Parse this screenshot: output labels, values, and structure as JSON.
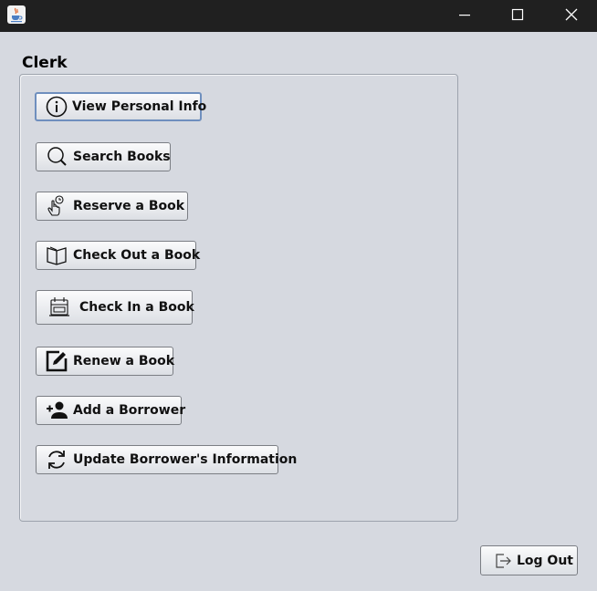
{
  "window": {
    "app_icon": "java-coffee-cup-icon",
    "controls": [
      "minimize-icon",
      "maximize-icon",
      "close-icon"
    ]
  },
  "panel": {
    "title": "Clerk",
    "buttons": [
      {
        "label": "View Personal Info",
        "icon": "info-icon"
      },
      {
        "label": "Search Books",
        "icon": "search-icon"
      },
      {
        "label": "Reserve a Book",
        "icon": "hand-clock-icon"
      },
      {
        "label": "Check Out a Book",
        "icon": "open-book-icon"
      },
      {
        "label": "Check In a Book",
        "icon": "book-return-icon"
      },
      {
        "label": "Renew a Book",
        "icon": "edit-icon"
      },
      {
        "label": "Add a Borrower",
        "icon": "add-user-icon"
      },
      {
        "label": "Update Borrower's Information",
        "icon": "refresh-icon"
      }
    ]
  },
  "footer": {
    "logout_label": "Log Out",
    "logout_icon": "logout-icon"
  }
}
